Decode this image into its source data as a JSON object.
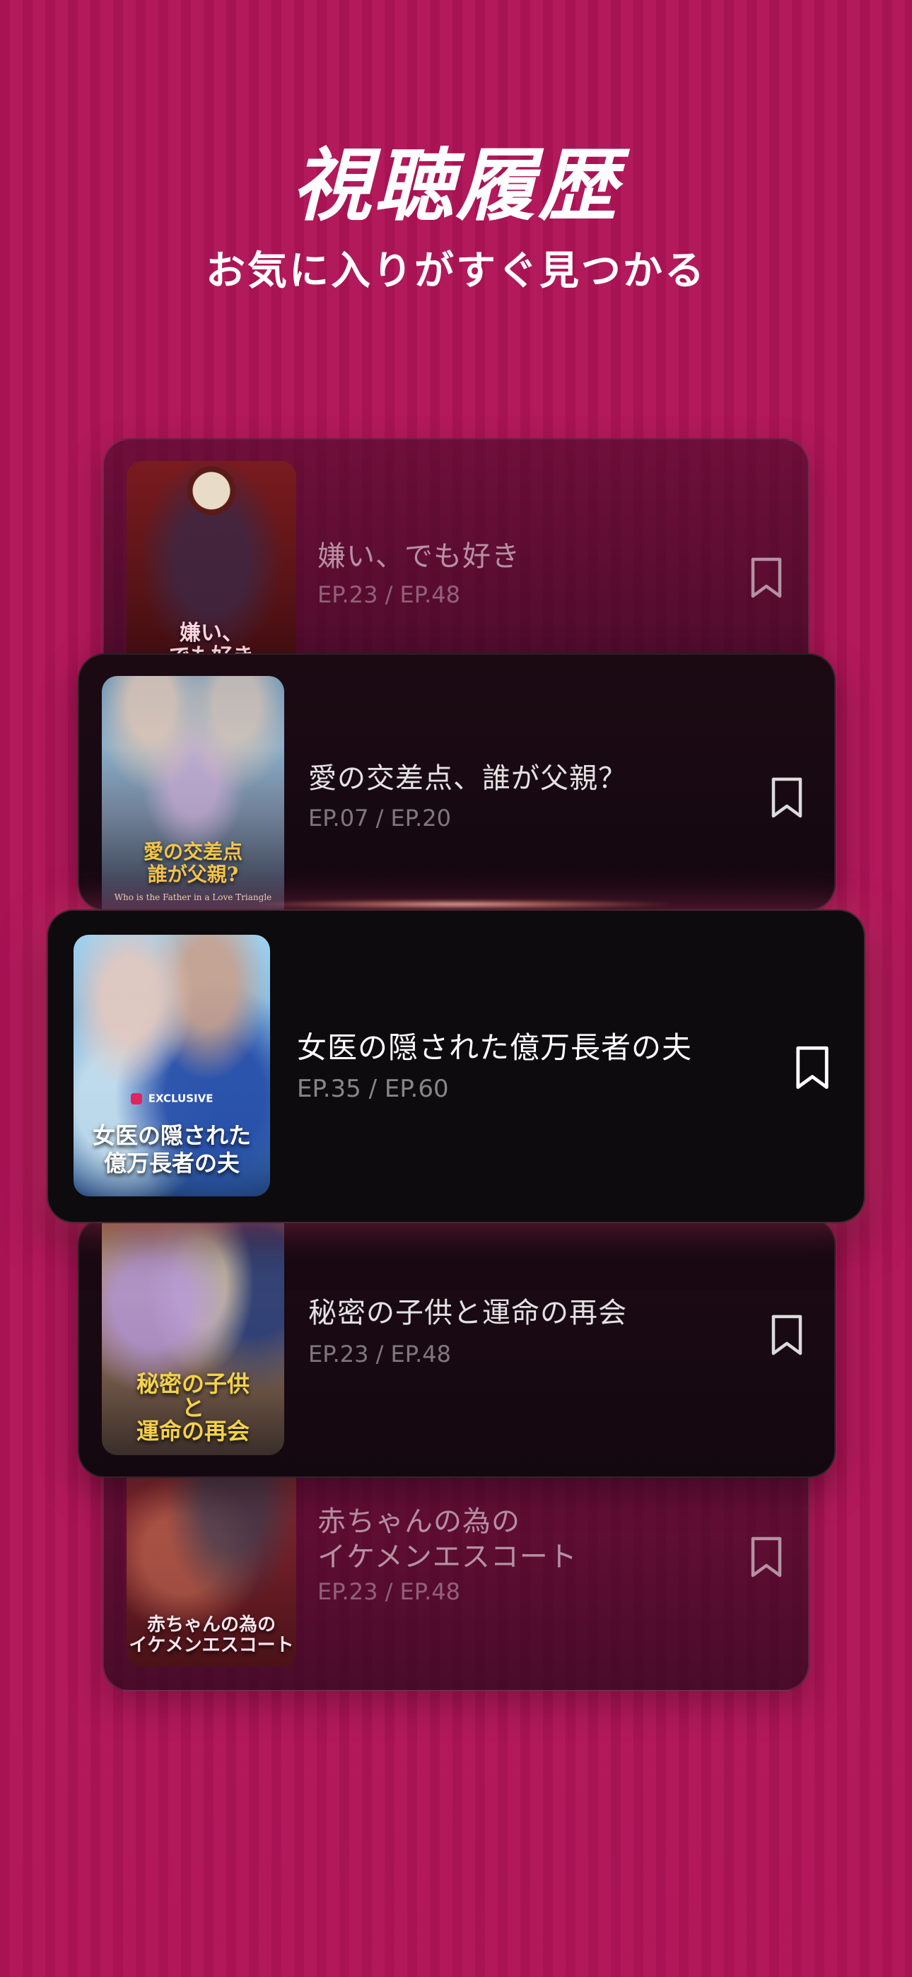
{
  "hero": {
    "title": "視聴履歴",
    "subtitle": "お気に入りがすぐ見つかる"
  },
  "history": [
    {
      "title": "嫌い、でも好き",
      "episodes": "EP.23 / EP.48",
      "poster_text": "嫌い、\nでも好き",
      "bookmark_icon": "bookmark-icon"
    },
    {
      "title": "愛の交差点、誰が父親？",
      "episodes": "EP.07 / EP.20",
      "poster_text": "愛の交差点\n誰が父親?",
      "poster_subtext": "Who is the Father in a Love Triangle",
      "bookmark_icon": "bookmark-icon"
    },
    {
      "title": "女医の隠された億万長者の夫",
      "episodes": "EP.35 / EP.60",
      "poster_badge": "EXCLUSIVE",
      "poster_text": "女医の隠された\n億万長者の夫",
      "bookmark_icon": "bookmark-icon"
    },
    {
      "title": "秘密の子供と運命の再会",
      "episodes": "EP.23 / EP.48",
      "poster_text": "秘密の子供\nと\n運命の再会",
      "bookmark_icon": "bookmark-icon"
    },
    {
      "title": "赤ちゃんの為の\nイケメンエスコート",
      "episodes": "EP.23 / EP.48",
      "poster_text": "赤ちゃんの為の\nイケメンエスコート",
      "bookmark_icon": "bookmark-icon"
    }
  ],
  "colors": {
    "background": "#b01457",
    "card_front": "#0e0b0e",
    "poster_gold_text": "#f3c64a",
    "poster_teal_text": "#7fe6ff"
  }
}
